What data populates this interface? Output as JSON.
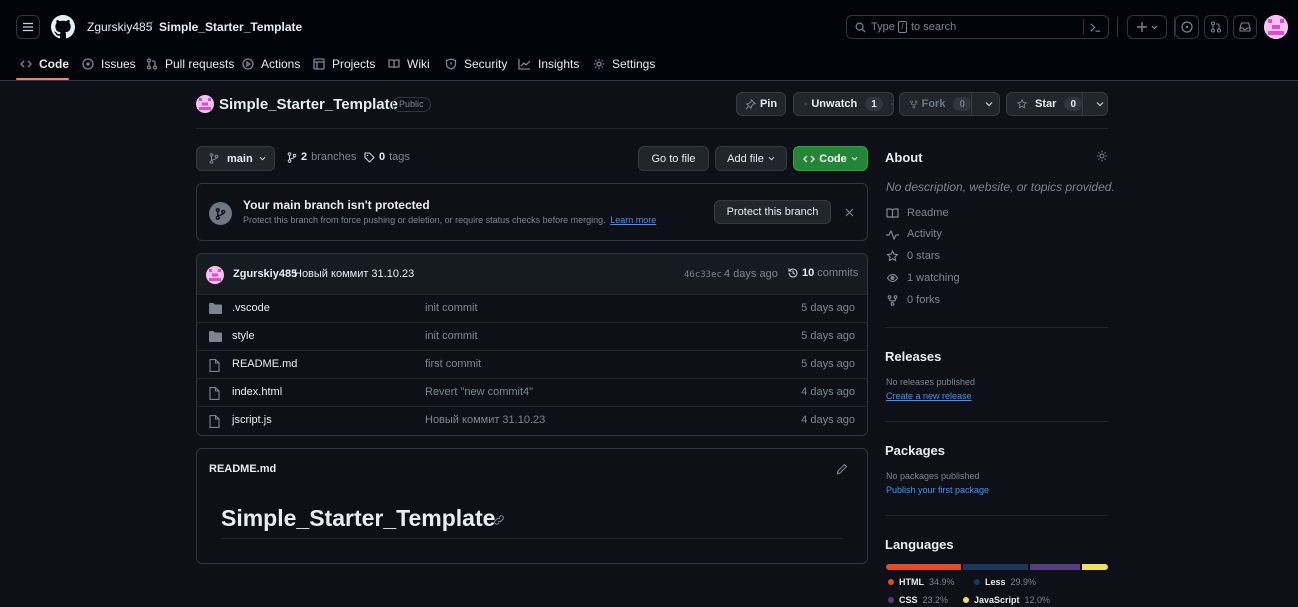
{
  "header": {
    "owner": "Zgurskiy485",
    "separator": "/",
    "repo": "Simple_Starter_Template",
    "search_prefix": "Type",
    "search_key": "/",
    "search_suffix": "to search"
  },
  "tabs": [
    {
      "label": "Code"
    },
    {
      "label": "Issues"
    },
    {
      "label": "Pull requests"
    },
    {
      "label": "Actions"
    },
    {
      "label": "Projects"
    },
    {
      "label": "Wiki"
    },
    {
      "label": "Security"
    },
    {
      "label": "Insights"
    },
    {
      "label": "Settings"
    }
  ],
  "repo": {
    "title": "Simple_Starter_Template",
    "visibility": "Public",
    "pin_label": "Pin",
    "unwatch_label": "Unwatch",
    "unwatch_count": "1",
    "fork_label": "Fork",
    "fork_count": "0",
    "star_label": "Star",
    "star_count": "0"
  },
  "toolbar": {
    "branch": "main",
    "branches_count": "2",
    "branches_label": "branches",
    "tags_count": "0",
    "tags_label": "tags",
    "goto_file": "Go to file",
    "add_file": "Add file",
    "code": "Code"
  },
  "protect": {
    "title": "Your main branch isn't protected",
    "desc": "Protect this branch from force pushing or deletion, or require status checks before merging.",
    "learn_more": "Learn more",
    "button": "Protect this branch"
  },
  "commit": {
    "author": "Zgurskiy485",
    "message": "Новый коммит 31.10.23",
    "sha": "46c33ec",
    "time": "4 days ago",
    "count": "10",
    "count_label": "commits"
  },
  "files": [
    {
      "type": "folder",
      "name": ".vscode",
      "message": "init commit",
      "date": "5 days ago"
    },
    {
      "type": "folder",
      "name": "style",
      "message": "init commit",
      "date": "5 days ago"
    },
    {
      "type": "file",
      "name": "README.md",
      "message": "first commit",
      "date": "5 days ago"
    },
    {
      "type": "file",
      "name": "index.html",
      "message": "Revert \"new commit4\"",
      "date": "4 days ago"
    },
    {
      "type": "file",
      "name": "jscript.js",
      "message": "Новый коммит 31.10.23",
      "date": "4 days ago"
    }
  ],
  "readme": {
    "filename": "README.md",
    "heading": "Simple_Starter_Template"
  },
  "about": {
    "title": "About",
    "description": "No description, website, or topics provided.",
    "readme": "Readme",
    "activity": "Activity",
    "stars": "0 stars",
    "watching": "1 watching",
    "forks": "0 forks"
  },
  "releases": {
    "title": "Releases",
    "none": "No releases published",
    "create": "Create a new release"
  },
  "packages": {
    "title": "Packages",
    "none": "No packages published",
    "publish": "Publish your first package"
  },
  "languages": {
    "title": "Languages",
    "items": [
      {
        "name": "HTML",
        "percent": "34.9%",
        "value": 34.9,
        "color": "#e34c26"
      },
      {
        "name": "Less",
        "percent": "29.9%",
        "value": 29.9,
        "color": "#1d365d"
      },
      {
        "name": "CSS",
        "percent": "23.2%",
        "value": 23.2,
        "color": "#563d7c"
      },
      {
        "name": "JavaScript",
        "percent": "12.0%",
        "value": 12.0,
        "color": "#f1e05a"
      }
    ]
  },
  "colors": {
    "accent": "#f78166",
    "green_button": "#238636",
    "link": "#4493f8"
  }
}
